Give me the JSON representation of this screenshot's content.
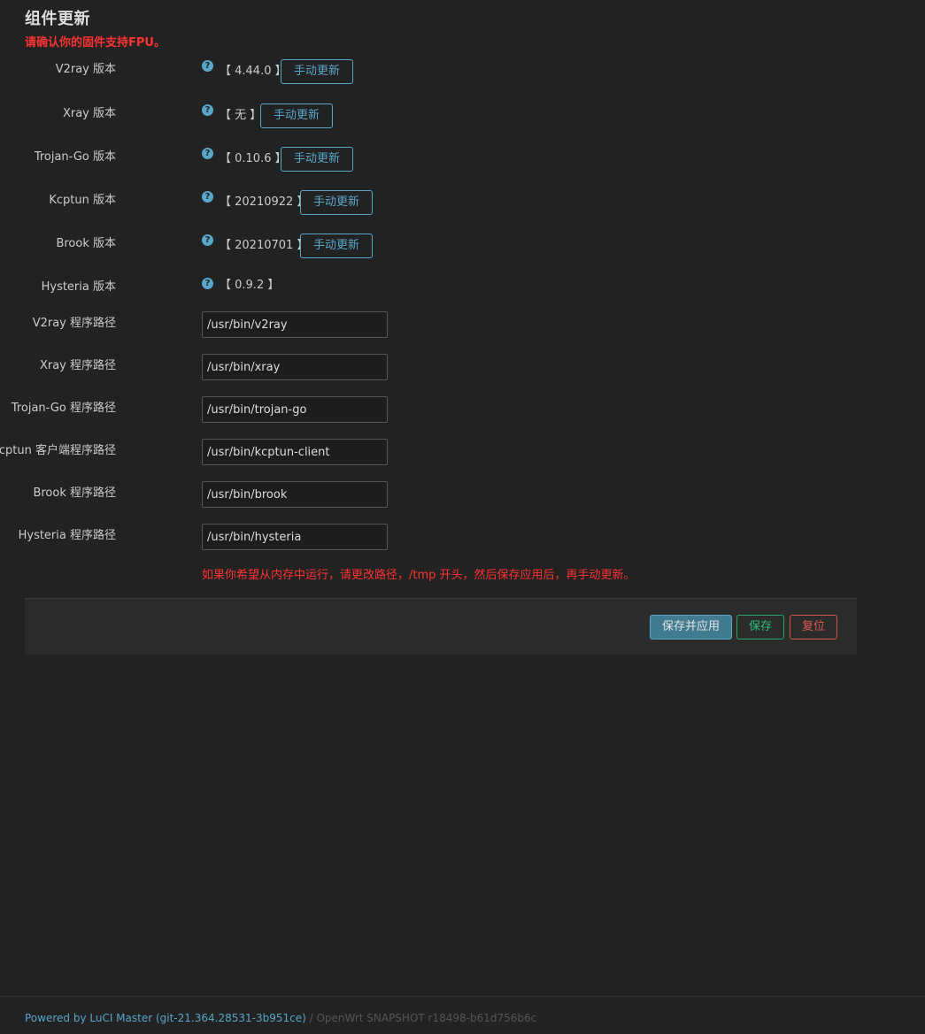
{
  "section": {
    "title": "组件更新",
    "description": "请确认你的固件支持FPU。"
  },
  "help_glyph": "?",
  "versions": [
    {
      "label": "V2ray 版本",
      "value": "【 4.44.0 】",
      "button": "手动更新"
    },
    {
      "label": "Xray 版本",
      "value": "【 无 】",
      "button": "手动更新"
    },
    {
      "label": "Trojan-Go 版本",
      "value": "【 0.10.6 】",
      "button": "手动更新"
    },
    {
      "label": "Kcptun 版本",
      "value": "【 20210922 】",
      "button": "手动更新"
    },
    {
      "label": "Brook 版本",
      "value": "【 20210701 】",
      "button": "手动更新"
    },
    {
      "label": "Hysteria 版本",
      "value": "【 0.9.2 】"
    }
  ],
  "paths": [
    {
      "label": "V2ray 程序路径",
      "value": "/usr/bin/v2ray"
    },
    {
      "label": "Xray 程序路径",
      "value": "/usr/bin/xray"
    },
    {
      "label": "Trojan-Go 程序路径",
      "value": "/usr/bin/trojan-go"
    },
    {
      "label": "Kcptun 客户端程序路径",
      "value": "/usr/bin/kcptun-client"
    },
    {
      "label": "Brook 程序路径",
      "value": "/usr/bin/brook"
    },
    {
      "label": "Hysteria 程序路径",
      "value": "/usr/bin/hysteria"
    }
  ],
  "note": "如果你希望从内存中运行，请更改路径，/tmp 开头，然后保存应用后，再手动更新。",
  "actions": {
    "save_apply": "保存并应用",
    "save": "保存",
    "reset": "复位"
  },
  "footer": {
    "powered": "Powered by LuCI Master (git-21.364.28531-3b951ce)",
    "separator": " / ",
    "build": "OpenWrt SNAPSHOT r18498-b61d756b6c"
  },
  "colors": {
    "background": "#222222",
    "accent": "#58a7c9",
    "warning_text": "#ff3333",
    "save_green": "#29a36a",
    "reset_red": "#d9534f"
  }
}
